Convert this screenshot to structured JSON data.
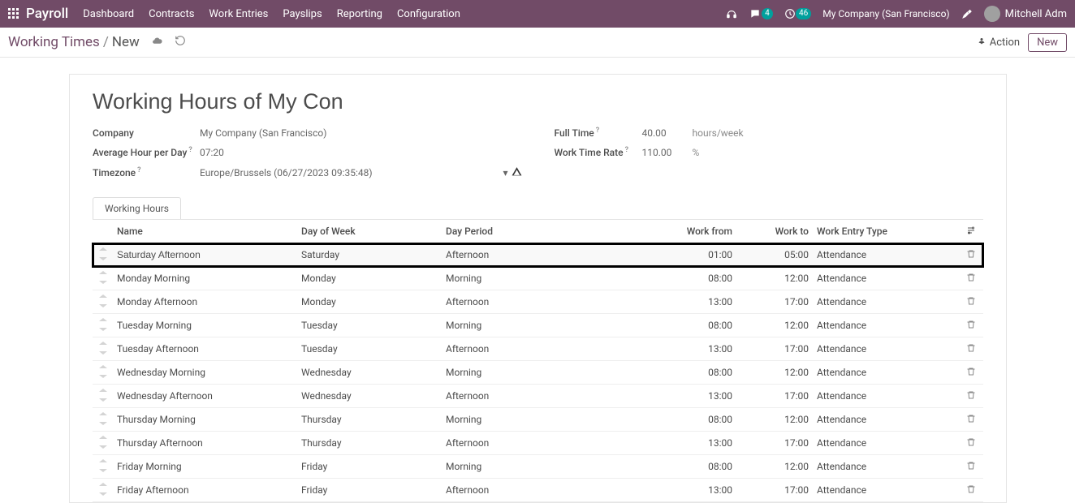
{
  "topbar": {
    "brand": "Payroll",
    "nav": [
      "Dashboard",
      "Contracts",
      "Work Entries",
      "Payslips",
      "Reporting",
      "Configuration"
    ],
    "chat_badge": "4",
    "activity_badge": "46",
    "company": "My Company (San Francisco)",
    "user": "Mitchell Adm"
  },
  "breadcrumb": {
    "root": "Working Times",
    "current": "New",
    "action_label": "Action",
    "new_label": "New"
  },
  "record": {
    "title": "Working Hours of My Con",
    "left_fields": {
      "company_label": "Company",
      "company_value": "My Company (San Francisco)",
      "avg_label": "Average Hour per Day",
      "avg_value": "07:20",
      "tz_label": "Timezone",
      "tz_value": "Europe/Brussels (06/27/2023 09:35:48)"
    },
    "right_fields": {
      "fulltime_label": "Full Time",
      "fulltime_value": "40.00",
      "fulltime_unit": "hours/week",
      "rate_label": "Work Time Rate",
      "rate_value": "110.00",
      "rate_unit": "%"
    }
  },
  "tab_label": "Working Hours",
  "grid": {
    "headers": {
      "name": "Name",
      "day": "Day of Week",
      "period": "Day Period",
      "from": "Work from",
      "to": "Work to",
      "type": "Work Entry Type"
    },
    "rows": [
      {
        "name": "Saturday Afternoon",
        "name_input": true,
        "day": "Saturday",
        "period": "Afternoon",
        "from": "01:00",
        "to": "05:00",
        "type": "Attendance",
        "highlight": true
      },
      {
        "name": "Monday Morning",
        "day": "Monday",
        "period": "Morning",
        "from": "08:00",
        "to": "12:00",
        "type": "Attendance"
      },
      {
        "name": "Monday Afternoon",
        "day": "Monday",
        "period": "Afternoon",
        "from": "13:00",
        "to": "17:00",
        "type": "Attendance"
      },
      {
        "name": "Tuesday Morning",
        "day": "Tuesday",
        "period": "Morning",
        "from": "08:00",
        "to": "12:00",
        "type": "Attendance"
      },
      {
        "name": "Tuesday Afternoon",
        "day": "Tuesday",
        "period": "Afternoon",
        "from": "13:00",
        "to": "17:00",
        "type": "Attendance"
      },
      {
        "name": "Wednesday Morning",
        "day": "Wednesday",
        "period": "Morning",
        "from": "08:00",
        "to": "12:00",
        "type": "Attendance"
      },
      {
        "name": "Wednesday Afternoon",
        "day": "Wednesday",
        "period": "Afternoon",
        "from": "13:00",
        "to": "17:00",
        "type": "Attendance"
      },
      {
        "name": "Thursday Morning",
        "day": "Thursday",
        "period": "Morning",
        "from": "08:00",
        "to": "12:00",
        "type": "Attendance"
      },
      {
        "name": "Thursday Afternoon",
        "day": "Thursday",
        "period": "Afternoon",
        "from": "13:00",
        "to": "17:00",
        "type": "Attendance"
      },
      {
        "name": "Friday Morning",
        "day": "Friday",
        "period": "Morning",
        "from": "08:00",
        "to": "12:00",
        "type": "Attendance"
      },
      {
        "name": "Friday Afternoon",
        "day": "Friday",
        "period": "Afternoon",
        "from": "13:00",
        "to": "17:00",
        "type": "Attendance"
      }
    ]
  }
}
